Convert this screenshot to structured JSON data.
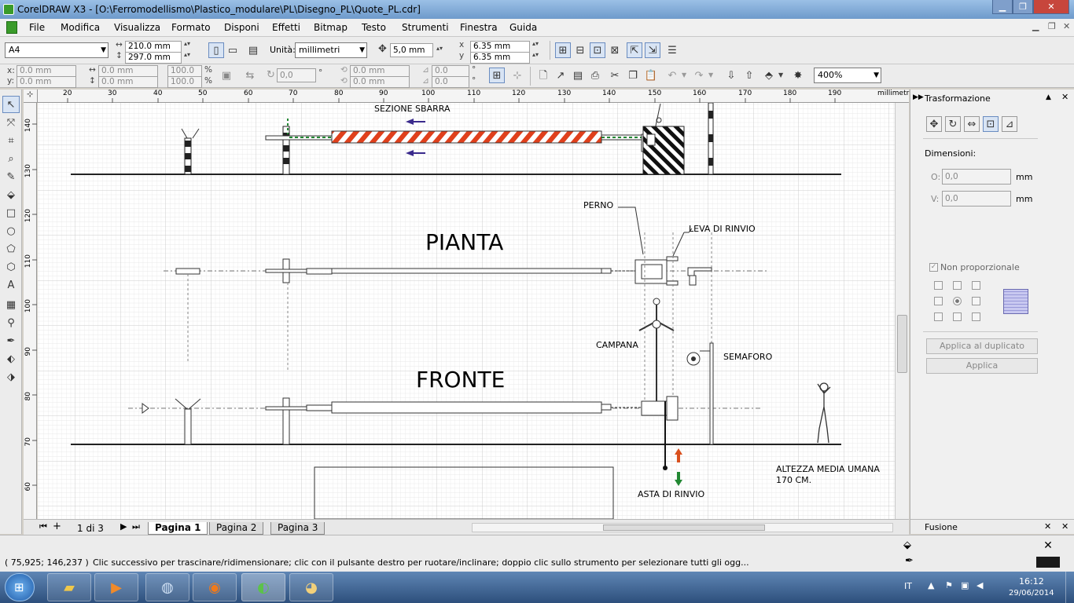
{
  "title": "CorelDRAW X3 - [O:\\Ferromodellismo\\Plastico_modulare\\PL\\Disegno_PL\\Quote_PL.cdr]",
  "menu": [
    "File",
    "Modifica",
    "Visualizza",
    "Formato",
    "Disponi",
    "Effetti",
    "Bitmap",
    "Testo",
    "Strumenti",
    "Finestra",
    "Guida"
  ],
  "propbar": {
    "page_size": "A4",
    "width": "210.0 mm",
    "height": "297.0 mm",
    "units_label": "Unità:",
    "units": "millimetri",
    "nudge": "5,0 mm",
    "dup_x": "6.35 mm",
    "dup_y": "6.35 mm",
    "x_prefix": "x",
    "y_prefix": "y"
  },
  "toolbar2": {
    "x_label": "x:",
    "y_label": "y:",
    "x": "0.0 mm",
    "y": "0.0 mm",
    "w": "0.0 mm",
    "h": "0.0 mm",
    "scale_x": "100.0",
    "scale_y": "100.0",
    "pct": "%",
    "rotation": "0,0",
    "deg": "°",
    "cx": "0.0 mm",
    "cy": "0.0 mm",
    "skew1": "0.0",
    "skew2": "0.0",
    "zoom": "400%"
  },
  "ruler": {
    "h_ticks": [
      "20",
      "30",
      "40",
      "50",
      "60",
      "70",
      "80",
      "90",
      "100",
      "110",
      "120",
      "130",
      "140",
      "150",
      "160",
      "170",
      "180",
      "190"
    ],
    "h_unit": "millimetri",
    "v_ticks": [
      "140",
      "130",
      "120",
      "110",
      "100",
      "90",
      "80",
      "70",
      "60"
    ],
    "v_unit": "millimetri"
  },
  "drawing": {
    "labels": {
      "sezione": "SEZIONE SBARRA",
      "pianta": "PIANTA",
      "fronte": "FRONTE",
      "perno": "PERNO",
      "leva": "LEVA DI RINVIO",
      "campana": "CAMPANA",
      "semaforo": "SEMAFORO",
      "asta": "ASTA DI RINVIO",
      "altezza1": "ALTEZZA MEDIA UMANA",
      "altezza2": "170 CM."
    },
    "colors": {
      "stripe_red": "#e0401c",
      "arrow_purple": "#3a2a8c",
      "green": "#228833",
      "arrow_orange": "#d9501e"
    }
  },
  "pages": {
    "count_label": "1 di 3",
    "tabs": [
      "Pagina 1",
      "Pagina 2",
      "Pagina 3"
    ]
  },
  "docker": {
    "title": "Trasformazione",
    "dimensions_label": "Dimensioni:",
    "o_label": "O:",
    "o_value": "0,0",
    "v_label": "V:",
    "v_value": "0,0",
    "unit": "mm",
    "non_prop_label": "Non proporzionale",
    "apply_dup": "Applica al duplicato",
    "apply": "Applica",
    "fusione": "Fusione"
  },
  "status": {
    "coords": "( 75,925; 146,237 )",
    "hint": "Clic successivo per trascinare/ridimensionare; clic con il pulsante destro per ruotare/inclinare; doppio clic sullo strumento per selezionare tutti gli ogg..."
  },
  "taskbar": {
    "lang": "IT",
    "time": "16:12",
    "date": "29/06/2014"
  }
}
